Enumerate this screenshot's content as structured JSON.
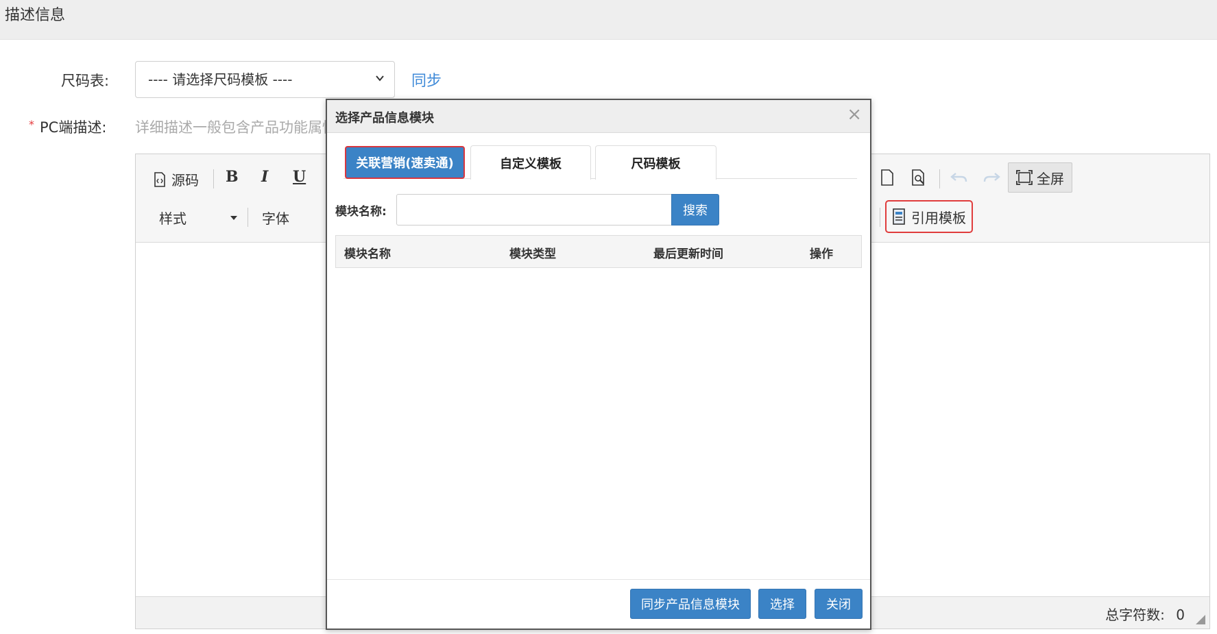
{
  "section": {
    "title": "描述信息"
  },
  "form": {
    "size_chart_label": "尺码表:",
    "size_chart_select_value": "---- 请选择尺码模板 ----",
    "sync_link": "同步",
    "required_mark": "*",
    "pc_desc_label": "PC端描述:",
    "pc_desc_placeholder": "详细描述一般包含产品功能属性"
  },
  "editor": {
    "toolbar": {
      "source": "源码",
      "bold": "B",
      "italic": "I",
      "underline": "U",
      "style_select": "样式",
      "font_select": "字体",
      "fullscreen": "全屏",
      "quote_template": "引用模板"
    },
    "status": {
      "char_count_label": "总字符数:",
      "char_count_value": "0"
    }
  },
  "modal": {
    "title": "选择产品信息模块",
    "close": "×",
    "tabs": [
      {
        "label": "关联营销(速卖通)",
        "active": true
      },
      {
        "label": "自定义模板",
        "active": false
      },
      {
        "label": "尺码模板",
        "active": false
      }
    ],
    "search_label": "模块名称:",
    "search_value": "",
    "search_button": "搜索",
    "table_headers": [
      "模块名称",
      "模块类型",
      "最后更新时间",
      "操作"
    ],
    "footer_buttons": {
      "sync": "同步产品信息模块",
      "select": "选择",
      "close": "关闭"
    }
  },
  "colors": {
    "primary": "#3b83c6",
    "link": "#3f8ad8",
    "highlight_border": "#e03c3c"
  }
}
